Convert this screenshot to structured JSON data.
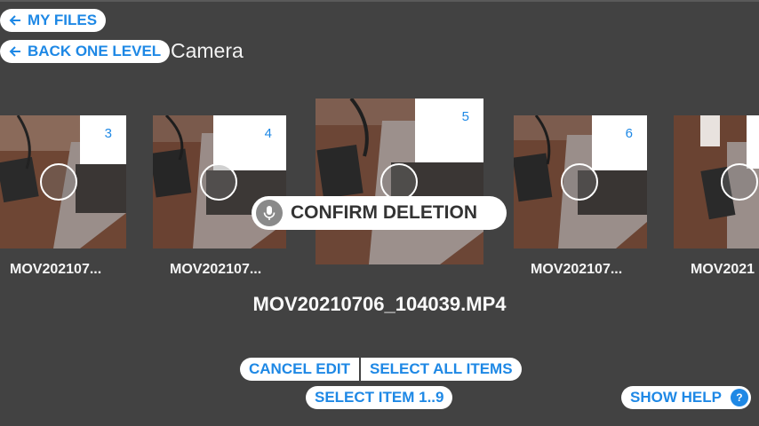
{
  "nav": {
    "my_files_label": "MY FILES",
    "back_label": "BACK ONE LEVEL",
    "folder_title": "Camera"
  },
  "thumbnails": [
    {
      "number": "3",
      "caption": "MOV202107..."
    },
    {
      "number": "4",
      "caption": "MOV202107..."
    },
    {
      "number": "5",
      "caption": ""
    },
    {
      "number": "6",
      "caption": "MOV202107..."
    },
    {
      "number": "",
      "caption": "MOV2021"
    }
  ],
  "selected_filename": "MOV20210706_104039.MP4",
  "voice_prompt": {
    "icon": "microphone-icon",
    "label": "CONFIRM DELETION"
  },
  "actions": {
    "cancel_edit": "CANCEL EDIT",
    "select_all": "SELECT ALL ITEMS",
    "select_item": "SELECT ITEM 1..9",
    "show_help": "SHOW HELP",
    "help_glyph": "?"
  },
  "colors": {
    "background": "#424242",
    "accent": "#1e88e5",
    "pill_bg": "#ffffff"
  }
}
